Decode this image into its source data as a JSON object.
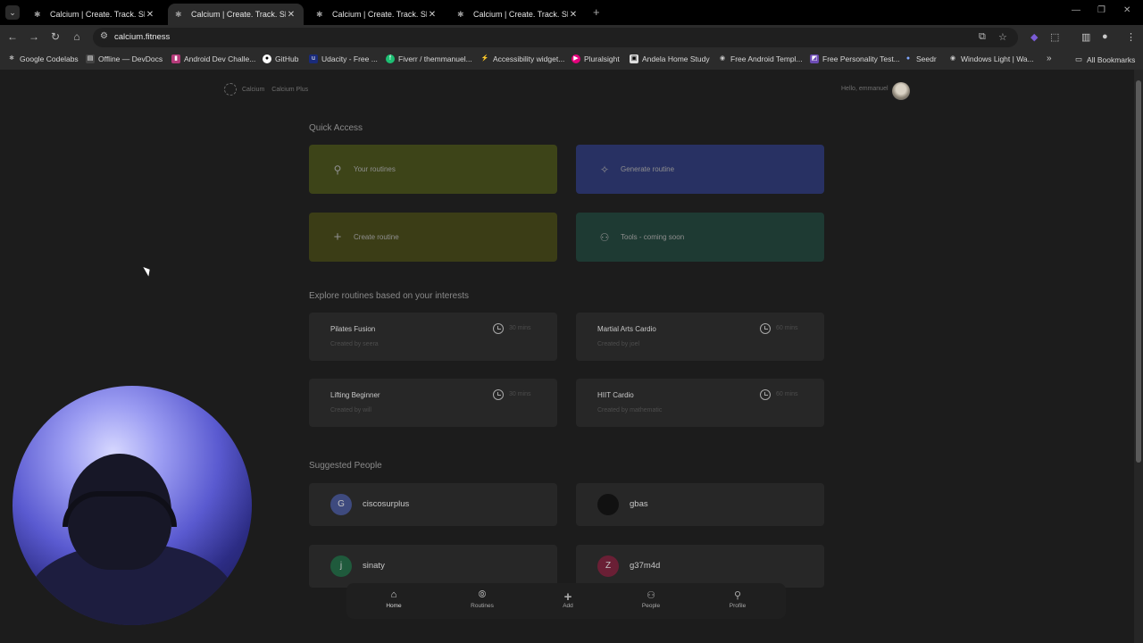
{
  "browser": {
    "tabs": [
      {
        "title": "Calcium | Create. Track. Share.",
        "active": false
      },
      {
        "title": "Calcium | Create. Track. Share.",
        "active": true
      },
      {
        "title": "Calcium | Create. Track. Share.",
        "active": false
      },
      {
        "title": "Calcium | Create. Track. Share.",
        "active": false
      }
    ],
    "url": "calcium.fitness",
    "bookmarks": [
      "Google Codelabs",
      "Offline — DevDocs",
      "Android Dev Challe...",
      "GitHub",
      "Udacity - Free ...",
      "Fiverr / themmanuel...",
      "Accessibility widget...",
      "Pluralsight",
      "Andela Home Study",
      "Free Android Templ...",
      "Free Personality Test...",
      "Seedr",
      "Windows Light | Wa..."
    ],
    "all_bookmarks": "All Bookmarks"
  },
  "header": {
    "brand": "Calcium",
    "plus": "Calcium Plus",
    "greeting": "Hello, emmanuel"
  },
  "quick_access": {
    "title": "Quick Access",
    "items": [
      {
        "label": "Your routines",
        "icon": "person-icon",
        "color": "#3d4418"
      },
      {
        "label": "Generate routine",
        "icon": "sparkle-icon",
        "color": "#283163"
      },
      {
        "label": "Create routine",
        "icon": "plus-icon",
        "color": "#3b3d16"
      },
      {
        "label": "Tools - coming soon",
        "icon": "people-icon",
        "color": "#1e3a33"
      }
    ]
  },
  "explore": {
    "title": "Explore routines based on your interests",
    "routines": [
      {
        "name": "Pilates Fusion",
        "creator": "Created by seera",
        "duration": "30 mins"
      },
      {
        "name": "Martial Arts Cardio",
        "creator": "Created by joel",
        "duration": "60 mins"
      },
      {
        "name": "Lifting Beginner",
        "creator": "Created by will",
        "duration": "30 mins"
      },
      {
        "name": "HIIT Cardio",
        "creator": "Created by mathematic",
        "duration": "60 mins"
      }
    ]
  },
  "suggested": {
    "title": "Suggested People",
    "people": [
      {
        "name": "ciscosurplus",
        "initial": "G",
        "color": "#3e4a7e"
      },
      {
        "name": "gbas",
        "initial": "",
        "color": "#111111"
      },
      {
        "name": "sinaty",
        "initial": "j",
        "color": "#1f5a3c"
      },
      {
        "name": "g37m4d",
        "initial": "Z",
        "color": "#6a1f35"
      }
    ]
  },
  "bottom_nav": [
    {
      "label": "Home",
      "icon": "home-icon"
    },
    {
      "label": "Routines",
      "icon": "routines-icon"
    },
    {
      "label": "Add",
      "icon": "plus-icon"
    },
    {
      "label": "People",
      "icon": "people-icon"
    },
    {
      "label": "Profile",
      "icon": "profile-icon"
    }
  ]
}
